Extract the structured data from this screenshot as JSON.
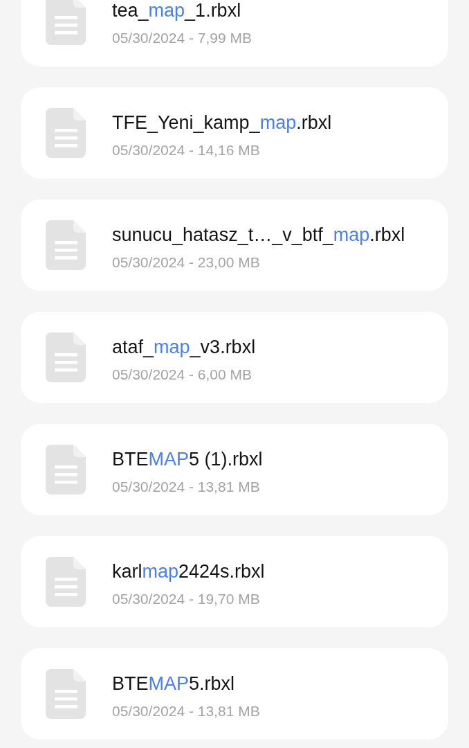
{
  "files": [
    {
      "name": [
        {
          "text": "tea_",
          "highlighted": false
        },
        {
          "text": "map",
          "highlighted": true
        },
        {
          "text": "_1.rbxl",
          "highlighted": false
        }
      ],
      "details": "05/30/2024 - 7,99 MB"
    },
    {
      "name": [
        {
          "text": "TFE_Yeni_kamp_",
          "highlighted": false
        },
        {
          "text": "map",
          "highlighted": true
        },
        {
          "text": ".rbxl",
          "highlighted": false
        }
      ],
      "details": "05/30/2024 - 14,16 MB"
    },
    {
      "name": [
        {
          "text": "sunucu_hatasz_t…_v_btf_",
          "highlighted": false
        },
        {
          "text": "map",
          "highlighted": true
        },
        {
          "text": ".rbxl",
          "highlighted": false
        }
      ],
      "details": "05/30/2024 - 23,00 MB"
    },
    {
      "name": [
        {
          "text": "ataf_",
          "highlighted": false
        },
        {
          "text": "map",
          "highlighted": true
        },
        {
          "text": "_v3.rbxl",
          "highlighted": false
        }
      ],
      "details": "05/30/2024 - 6,00 MB"
    },
    {
      "name": [
        {
          "text": "BTE",
          "highlighted": false
        },
        {
          "text": "MAP",
          "highlighted": true
        },
        {
          "text": "5 (1).rbxl",
          "highlighted": false
        }
      ],
      "details": "05/30/2024 - 13,81 MB"
    },
    {
      "name": [
        {
          "text": "karl",
          "highlighted": false
        },
        {
          "text": "map",
          "highlighted": true
        },
        {
          "text": "2424s.rbxl",
          "highlighted": false
        }
      ],
      "details": "05/30/2024 - 19,70 MB"
    },
    {
      "name": [
        {
          "text": "BTE",
          "highlighted": false
        },
        {
          "text": "MAP",
          "highlighted": true
        },
        {
          "text": "5.rbxl",
          "highlighted": false
        }
      ],
      "details": "05/30/2024 - 13,81 MB"
    }
  ]
}
